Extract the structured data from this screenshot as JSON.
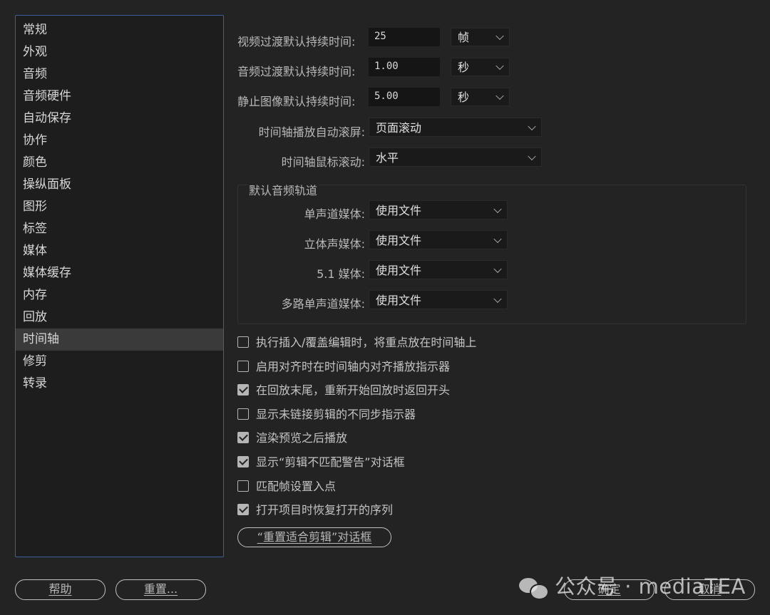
{
  "sidebar": {
    "items": [
      {
        "label": "常规"
      },
      {
        "label": "外观"
      },
      {
        "label": "音频"
      },
      {
        "label": "音频硬件"
      },
      {
        "label": "自动保存"
      },
      {
        "label": "协作"
      },
      {
        "label": "颜色"
      },
      {
        "label": "操纵面板"
      },
      {
        "label": "图形"
      },
      {
        "label": "标签"
      },
      {
        "label": "媒体"
      },
      {
        "label": "媒体缓存"
      },
      {
        "label": "内存"
      },
      {
        "label": "回放"
      },
      {
        "label": "时间轴"
      },
      {
        "label": "修剪"
      },
      {
        "label": "转录"
      }
    ],
    "selected": "时间轴"
  },
  "durations": {
    "video_label": "视频过渡默认持续时间:",
    "video_value": "25",
    "video_unit": "帧",
    "audio_label": "音频过渡默认持续时间:",
    "audio_value": "1.00",
    "audio_unit": "秒",
    "still_label": "静止图像默认持续时间:",
    "still_value": "5.00",
    "still_unit": "秒"
  },
  "timeline": {
    "autoscroll_label": "时间轴播放自动滚屏:",
    "autoscroll_value": "页面滚动",
    "mousescroll_label": "时间轴鼠标滚动:",
    "mousescroll_value": "水平"
  },
  "audio_tracks": {
    "title": "默认音频轨道",
    "mono_label": "单声道媒体:",
    "mono_value": "使用文件",
    "stereo_label": "立体声媒体:",
    "stereo_value": "使用文件",
    "surround_label": "5.1 媒体:",
    "surround_value": "使用文件",
    "multimono_label": "多路单声道媒体:",
    "multimono_value": "使用文件"
  },
  "checkboxes": [
    {
      "label": "执行插入/覆盖编辑时，将重点放在时间轴上",
      "checked": false
    },
    {
      "label": "启用对齐时在时间轴内对齐播放指示器",
      "checked": false
    },
    {
      "label": "在回放末尾，重新开始回放时返回开头",
      "checked": true
    },
    {
      "label": "显示未链接剪辑的不同步指示器",
      "checked": false
    },
    {
      "label": "渲染预览之后播放",
      "checked": true
    },
    {
      "label": "显示“剪辑不匹配警告”对话框",
      "checked": true
    },
    {
      "label": "匹配帧设置入点",
      "checked": false
    },
    {
      "label": "打开项目时恢复打开的序列",
      "checked": true
    }
  ],
  "buttons": {
    "reset_fit_clip": "“重置适合剪辑”对话框",
    "help": "帮助",
    "reset": "重置...",
    "ok": "确定",
    "cancel": "取消"
  },
  "watermark": "公众号 · mediaTEA"
}
